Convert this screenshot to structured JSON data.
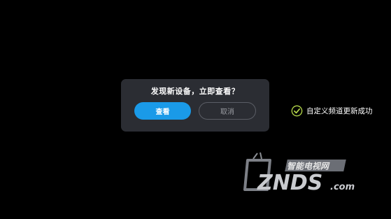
{
  "dialog": {
    "title": "发现新设备，立即查看？",
    "view_label": "查看",
    "cancel_label": "取消"
  },
  "toast": {
    "icon": "check-circle-icon",
    "message": "自定义频道更新成功"
  },
  "watermark": {
    "brand": "ZNDS",
    "domain_suffix": ".com",
    "tagline": "智能电视网"
  },
  "colors": {
    "background": "#000000",
    "dialog_bg": "#2b2d33",
    "primary_button": "#1a9ae8",
    "check_icon": "#b5d84a"
  }
}
